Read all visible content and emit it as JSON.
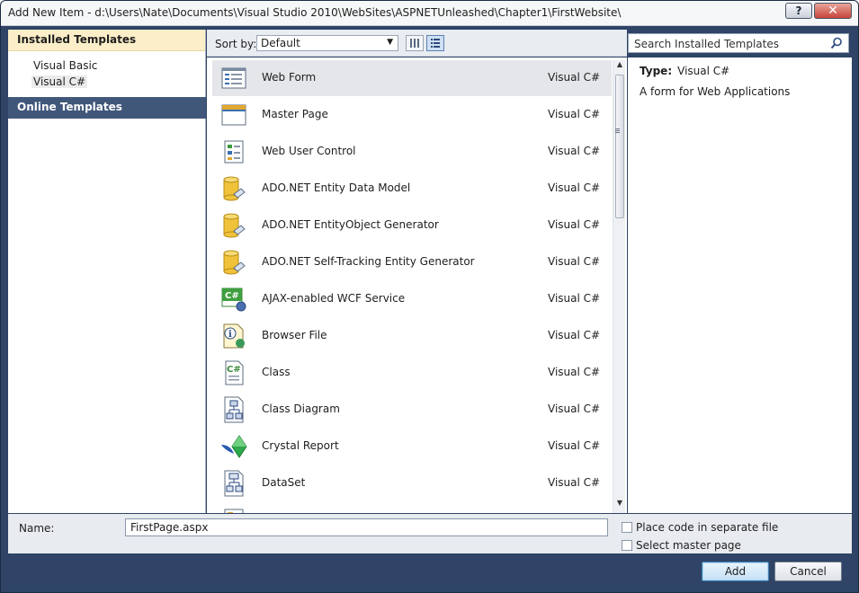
{
  "window": {
    "title": "Add New Item - d:\\Users\\Nate\\Documents\\Visual Studio 2010\\WebSites\\ASPNETUnleashed\\Chapter1\\FirstWebsite\\",
    "help_label": "?",
    "close_label": "✕"
  },
  "sidebar": {
    "installed_header": "Installed Templates",
    "items": [
      "Visual Basic",
      "Visual C#"
    ],
    "selected": "Visual C#",
    "online_header": "Online Templates"
  },
  "toolbar": {
    "sort_label": "Sort by:",
    "sort_value": "Default"
  },
  "search": {
    "placeholder": "Search Installed Templates"
  },
  "templates": [
    {
      "name": "Web Form",
      "lang": "Visual C#",
      "icon": "web-form-icon"
    },
    {
      "name": "Master Page",
      "lang": "Visual C#",
      "icon": "master-page-icon"
    },
    {
      "name": "Web User Control",
      "lang": "Visual C#",
      "icon": "user-control-icon"
    },
    {
      "name": "ADO.NET Entity Data Model",
      "lang": "Visual C#",
      "icon": "database-icon"
    },
    {
      "name": "ADO.NET EntityObject Generator",
      "lang": "Visual C#",
      "icon": "database-icon"
    },
    {
      "name": "ADO.NET Self-Tracking Entity Generator",
      "lang": "Visual C#",
      "icon": "database-icon"
    },
    {
      "name": "AJAX-enabled WCF Service",
      "lang": "Visual C#",
      "icon": "wcf-service-icon"
    },
    {
      "name": "Browser File",
      "lang": "Visual C#",
      "icon": "browser-file-icon"
    },
    {
      "name": "Class",
      "lang": "Visual C#",
      "icon": "class-icon"
    },
    {
      "name": "Class Diagram",
      "lang": "Visual C#",
      "icon": "class-diagram-icon"
    },
    {
      "name": "Crystal Report",
      "lang": "Visual C#",
      "icon": "crystal-report-icon"
    },
    {
      "name": "DataSet",
      "lang": "Visual C#",
      "icon": "dataset-icon"
    }
  ],
  "details": {
    "type_label": "Type:",
    "type_value": "Visual C#",
    "description": "A form for Web Applications"
  },
  "form": {
    "name_label": "Name:",
    "name_value": "FirstPage.aspx",
    "separate_file_label": "Place code in separate file",
    "master_page_label": "Select master page"
  },
  "buttons": {
    "add": "Add",
    "cancel": "Cancel"
  },
  "colors": {
    "frame": "#2f4466",
    "installed_header_bg": "#fbeec8",
    "online_header_bg": "#41577a",
    "selected_row": "#e4e6ea"
  }
}
